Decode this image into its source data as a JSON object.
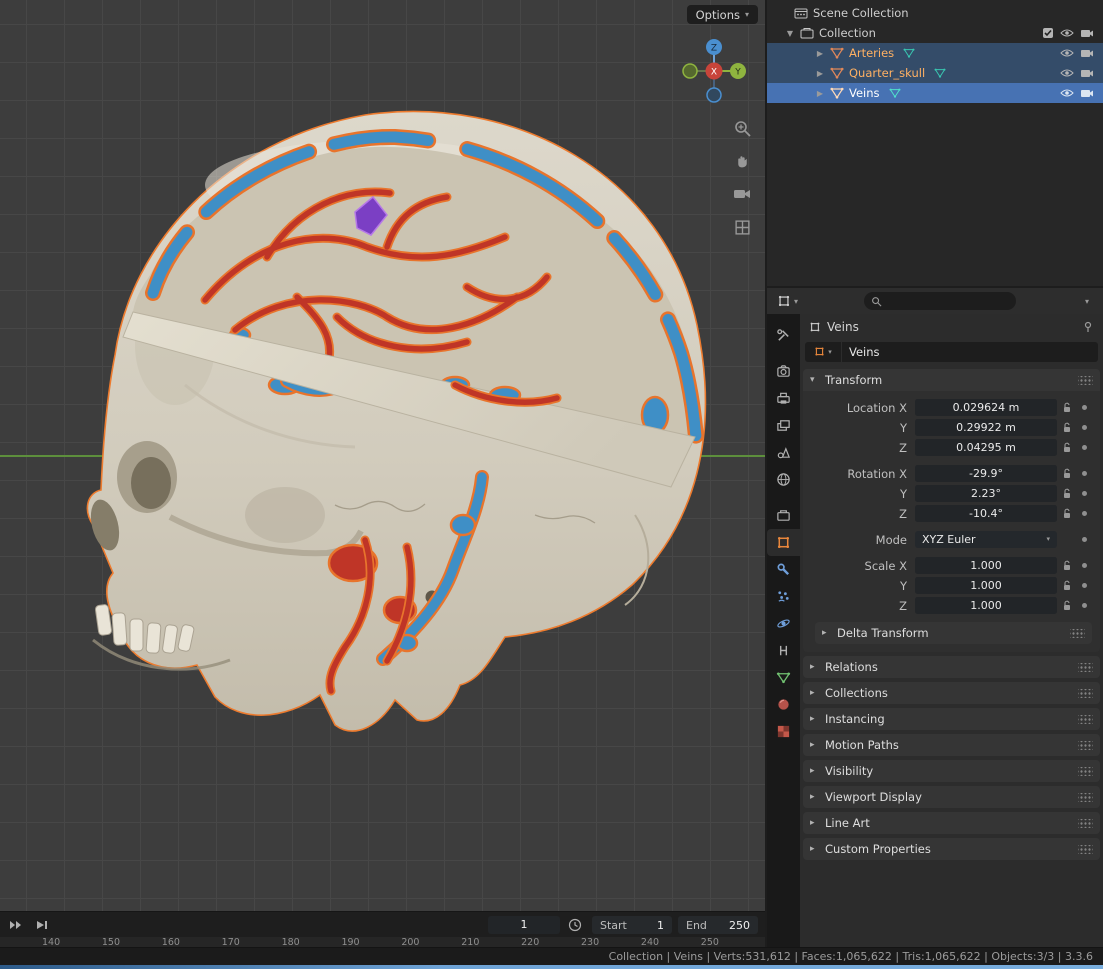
{
  "colors": {
    "accent_orange": "#e8883c",
    "selection_blue": "#4772b3",
    "artery_red": "#bf3527",
    "vein_blue": "#3f8fc6",
    "outline_orange": "#ed7b2e",
    "axis_green": "#5d8f3c"
  },
  "viewport": {
    "options_label": "Options",
    "gizmo": {
      "x_label": "X",
      "y_label": "Y",
      "z_label": "Z"
    },
    "tool_icons": [
      "zoom-icon",
      "hand-icon",
      "camera-view-icon",
      "grid-ortho-icon"
    ]
  },
  "outliner": {
    "scene_collection_label": "Scene Collection",
    "collection_label": "Collection",
    "items": [
      {
        "label": "Arteries"
      },
      {
        "label": "Quarter_skull"
      },
      {
        "label": "Veins"
      }
    ],
    "row_icons": [
      "mesh-icon",
      "mesh-data-icon",
      "eye-icon",
      "camera-icon",
      "checkbox"
    ]
  },
  "properties": {
    "breadcrumb_object": "Veins",
    "name_value": "Veins",
    "search_placeholder": "",
    "transform_title": "Transform",
    "transform_rows": [
      {
        "label": "Location X",
        "value": "0.029624 m"
      },
      {
        "label": "Y",
        "value": "0.29922 m"
      },
      {
        "label": "Z",
        "value": "0.04295 m"
      },
      {
        "label": "Rotation X",
        "value": "-29.9°"
      },
      {
        "label": "Y",
        "value": "2.23°"
      },
      {
        "label": "Z",
        "value": "-10.4°"
      },
      {
        "label": "Mode",
        "value": "XYZ Euler"
      },
      {
        "label": "Scale X",
        "value": "1.000"
      },
      {
        "label": "Y",
        "value": "1.000"
      },
      {
        "label": "Z",
        "value": "1.000"
      }
    ],
    "delta_transform_label": "Delta Transform",
    "sections": [
      "Relations",
      "Collections",
      "Instancing",
      "Motion Paths",
      "Visibility",
      "Viewport Display",
      "Line Art",
      "Custom Properties"
    ],
    "tab_icons": [
      "tool-icon",
      "render-icon",
      "output-icon",
      "view-layer-icon",
      "scene-icon",
      "world-icon",
      "collection-icon",
      "object-icon",
      "modifiers-icon",
      "particles-icon",
      "physics-icon",
      "constraints-icon",
      "object-data-icon",
      "material-icon",
      "texture-icon"
    ]
  },
  "timeline": {
    "current_frame": "1",
    "start_label": "Start",
    "start_value": "1",
    "end_label": "End",
    "end_value": "250",
    "ruler": [
      "140",
      "150",
      "160",
      "170",
      "180",
      "190",
      "200",
      "210",
      "220",
      "230",
      "240",
      "250"
    ]
  },
  "status_bar": {
    "text": "Collection | Veins | Verts:531,612 | Faces:1,065,622 | Tris:1,065,622 | Objects:3/3 | 3.3.6"
  }
}
